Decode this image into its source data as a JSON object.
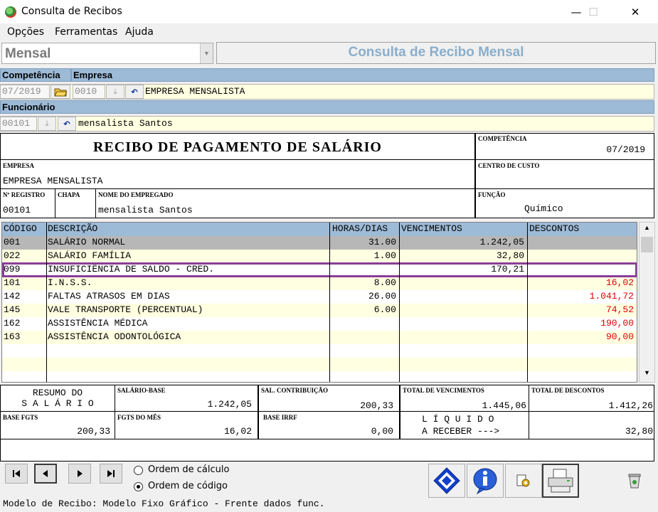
{
  "window": {
    "title": "Consulta de Recibos",
    "minimize": "—",
    "maximize": "☐",
    "close": "✕"
  },
  "menu": [
    "Opções",
    "Ferramentas",
    "Ajuda"
  ],
  "combo": {
    "value": "Mensal"
  },
  "header_title": "Consulta de Recibo Mensal",
  "competencia_label": "Competência",
  "empresa_label": "Empresa",
  "competencia_value": "07/2019",
  "empresa_code": "0010",
  "empresa_name": "EMPRESA MENSALISTA",
  "funcionario_label": "Funcionário",
  "funcionario_code": "00101",
  "funcionario_name": "mensalista Santos",
  "receipt": {
    "title": "RECIBO DE PAGAMENTO DE SALÁRIO",
    "competencia_label": "COMPETÊNCIA",
    "competencia": "07/2019",
    "empresa_label": "EMPRESA",
    "empresa": "EMPRESA MENSALISTA",
    "centro_label": "CENTRO DE CUSTO",
    "centro": "",
    "registro_label": "Nº REGISTRO",
    "registro": "00101",
    "chapa_label": "CHAPA",
    "chapa": "",
    "nome_label": "NOME DO EMPREGADO",
    "nome": "mensalista Santos",
    "funcao_label": "FUNÇÃO",
    "funcao": "Químico"
  },
  "grid": {
    "headers": {
      "code": "CÓDIGO",
      "desc": "DESCRIÇÃO",
      "hours": "HORAS/DIAS",
      "venc": "VENCIMENTOS",
      "desc_total": "DESCONTOS"
    },
    "rows": [
      {
        "code": "001",
        "desc": "SALÁRIO NORMAL",
        "hours": "31.00",
        "venc": "1.242,05",
        "descontos": ""
      },
      {
        "code": "022",
        "desc": "SALÁRIO FAMÍLIA",
        "hours": "1.00",
        "venc": "32,80",
        "descontos": ""
      },
      {
        "code": "099",
        "desc": "INSUFICIÊNCIA DE SALDO - CRED.",
        "hours": "",
        "venc": "170,21",
        "descontos": ""
      },
      {
        "code": "101",
        "desc": "I.N.S.S.",
        "hours": "8.00",
        "venc": "",
        "descontos": "16,02"
      },
      {
        "code": "142",
        "desc": "FALTAS ATRASOS EM DIAS",
        "hours": "26.00",
        "venc": "",
        "descontos": "1.041,72"
      },
      {
        "code": "145",
        "desc": "VALE TRANSPORTE (PERCENTUAL)",
        "hours": "6.00",
        "venc": "",
        "descontos": "74,52"
      },
      {
        "code": "162",
        "desc": "ASSISTÊNCIA MÉDICA",
        "hours": "",
        "venc": "",
        "descontos": "190,00"
      },
      {
        "code": "163",
        "desc": "ASSISTÊNCIA ODONTOLÓGICA",
        "hours": "",
        "venc": "",
        "descontos": "90,00"
      }
    ],
    "highlight_color": "#8a3d9a",
    "desconto_color": "#e00000"
  },
  "summary": {
    "resumo_line1": "RESUMO DO",
    "resumo_line2": "S A L Á R I O",
    "salario_base_label": "SALÁRIO-BASE",
    "salario_base": "1.242,05",
    "sal_contrib_label": "SAL. CONTRIBUIÇÃO",
    "sal_contrib": "200,33",
    "total_venc_label": "TOTAL DE VENCIMENTOS",
    "total_venc": "1.445,06",
    "total_desc_label": "TOTAL DE DESCONTOS",
    "total_desc": "1.412,26",
    "base_fgts_label": "BASE FGTS",
    "base_fgts": "200,33",
    "fgts_mes_label": "FGTS DO MÊS",
    "fgts_mes": "16,02",
    "base_irrf_label": "BASE IRRF",
    "base_irrf": "0,00",
    "liquido_line1": "L Í Q U I D O",
    "liquido_line2": "A RECEBER --->",
    "liquido": "32,80"
  },
  "radios": {
    "ordem_calculo": "Ordem de cálculo",
    "ordem_codigo": "Ordem de código"
  },
  "status": "Modelo de Recibo: Modelo Fixo Gráfico - Frente dados func."
}
